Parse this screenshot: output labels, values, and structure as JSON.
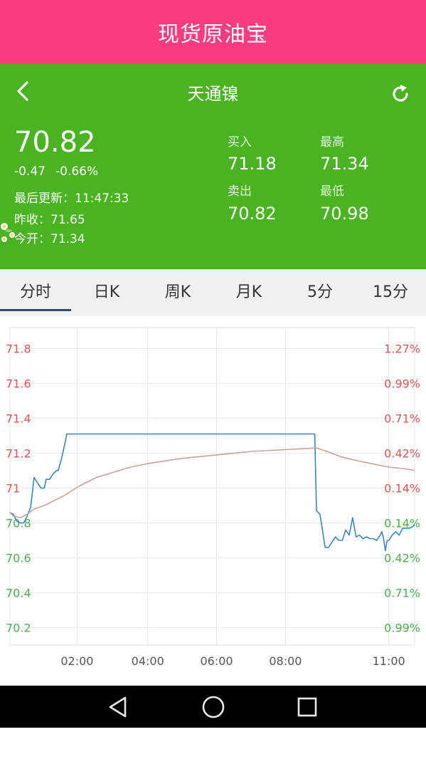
{
  "app_title": "现货原油宝",
  "header": {
    "product_name": "天通镍",
    "back_icon": "chevron-left-icon",
    "refresh_icon": "refresh-icon"
  },
  "quote": {
    "price": "70.82",
    "change": "-0.47",
    "change_pct": "-0.66%",
    "update_label": "最后更新：",
    "update_time": "11:47:33",
    "prev_close_label": "昨收：",
    "prev_close": "71.65",
    "open_label": "今开：",
    "open": "71.34",
    "buy_label": "买入",
    "buy": "71.18",
    "high_label": "最高",
    "high": "71.34",
    "sell_label": "卖出",
    "sell": "70.82",
    "low_label": "最低",
    "low": "70.98"
  },
  "tabs": [
    {
      "label": "分时",
      "active": true
    },
    {
      "label": "日K"
    },
    {
      "label": "周K"
    },
    {
      "label": "月K"
    },
    {
      "label": "5分"
    },
    {
      "label": "15分"
    }
  ],
  "colors": {
    "title_bar": "#fb3b7f",
    "quote_panel": "#49b321",
    "price_line": "#3a85c9",
    "avg_line": "#c8a197",
    "up_axis": "#e05555",
    "down_axis": "#4caf50"
  },
  "chart_data": {
    "type": "line",
    "x_ticks": [
      "02:00",
      "04:00",
      "06:00",
      "08:00",
      "11:00"
    ],
    "y_ticks_left": [
      "71.8",
      "71.6",
      "71.4",
      "71.2",
      "71",
      "70.8",
      "70.6",
      "70.4",
      "70.2"
    ],
    "y_ticks_right": [
      "1.27%",
      "0.99%",
      "0.71%",
      "0.42%",
      "0.14%",
      "0.14%",
      "0.42%",
      "0.71%",
      "0.99%"
    ],
    "ylim": [
      70.1,
      71.92
    ],
    "series": [
      {
        "role": "price",
        "points": [
          [
            0.0,
            70.86
          ],
          [
            0.1,
            70.85
          ],
          [
            0.2,
            70.81
          ],
          [
            0.3,
            70.8
          ],
          [
            0.4,
            70.8
          ],
          [
            0.5,
            70.84
          ],
          [
            0.6,
            70.89
          ],
          [
            0.7,
            71.06
          ],
          [
            0.8,
            71.03
          ],
          [
            0.9,
            71.0
          ],
          [
            1.0,
            71.0
          ],
          [
            1.05,
            71.05
          ],
          [
            1.15,
            71.05
          ],
          [
            1.25,
            71.08
          ],
          [
            1.35,
            71.1
          ],
          [
            1.4,
            71.1
          ],
          [
            1.5,
            71.17
          ],
          [
            1.6,
            71.26
          ],
          [
            1.65,
            71.31
          ],
          [
            2.0,
            71.31
          ],
          [
            4.0,
            71.31
          ],
          [
            6.0,
            71.31
          ],
          [
            8.0,
            71.31
          ],
          [
            8.85,
            71.31
          ],
          [
            8.9,
            70.87
          ],
          [
            9.0,
            70.85
          ],
          [
            9.05,
            70.79
          ],
          [
            9.15,
            70.66
          ],
          [
            9.25,
            70.66
          ],
          [
            9.35,
            70.69
          ],
          [
            9.45,
            70.72
          ],
          [
            9.55,
            70.7
          ],
          [
            9.65,
            70.7
          ],
          [
            9.75,
            70.76
          ],
          [
            9.85,
            70.73
          ],
          [
            9.95,
            70.83
          ],
          [
            10.05,
            70.72
          ],
          [
            10.15,
            70.73
          ],
          [
            10.25,
            70.71
          ],
          [
            10.35,
            70.72
          ],
          [
            10.45,
            70.71
          ],
          [
            10.55,
            70.71
          ],
          [
            10.65,
            70.7
          ],
          [
            10.75,
            70.73
          ],
          [
            10.8,
            70.75
          ],
          [
            10.85,
            70.71
          ],
          [
            10.9,
            70.64
          ],
          [
            10.95,
            70.7
          ],
          [
            11.0,
            70.7
          ],
          [
            11.1,
            70.73
          ],
          [
            11.2,
            70.75
          ],
          [
            11.3,
            70.73
          ],
          [
            11.4,
            70.77
          ],
          [
            11.5,
            70.77
          ],
          [
            11.6,
            70.77
          ],
          [
            11.7,
            70.78
          ],
          [
            11.75,
            70.79
          ]
        ]
      },
      {
        "role": "average",
        "points": [
          [
            0.0,
            70.86
          ],
          [
            0.1,
            70.84
          ],
          [
            0.3,
            70.83
          ],
          [
            0.5,
            70.85
          ],
          [
            0.7,
            70.88
          ],
          [
            1.0,
            70.9
          ],
          [
            1.3,
            70.93
          ],
          [
            1.6,
            70.96
          ],
          [
            2.0,
            71.01
          ],
          [
            2.5,
            71.06
          ],
          [
            3.0,
            71.09
          ],
          [
            3.5,
            71.12
          ],
          [
            4.0,
            71.14
          ],
          [
            5.0,
            71.17
          ],
          [
            6.0,
            71.19
          ],
          [
            7.0,
            71.21
          ],
          [
            8.0,
            71.22
          ],
          [
            8.9,
            71.23
          ],
          [
            9.2,
            71.21
          ],
          [
            9.6,
            71.18
          ],
          [
            10.0,
            71.16
          ],
          [
            10.5,
            71.14
          ],
          [
            11.0,
            71.12
          ],
          [
            11.5,
            71.11
          ],
          [
            11.75,
            71.1
          ]
        ]
      }
    ],
    "x_range_hours": [
      0.0,
      11.75
    ]
  },
  "system_nav": {
    "back_icon": "nav-back-icon",
    "home_icon": "nav-home-icon",
    "recent_icon": "nav-recent-icon"
  }
}
